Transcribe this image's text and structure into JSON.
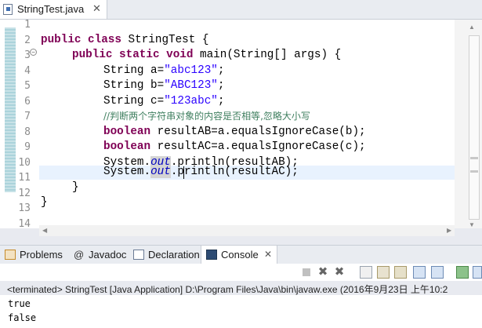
{
  "editor": {
    "tab_label": "StringTest.java",
    "tab_close": "✕",
    "line_numbers": [
      "1",
      "2",
      "3",
      "4",
      "5",
      "6",
      "7",
      "8",
      "9",
      "10",
      "11",
      "12",
      "13",
      "14"
    ],
    "code": {
      "l2_kw": "public class",
      "l2_rest": " StringTest {",
      "l3_kw": "public static void",
      "l3_rest": " main(String[] ",
      "l3_param": "args",
      "l3_end": ") {",
      "l4_pre": "String a=",
      "l4_str": "\"abc123\"",
      "l5_pre": "String b=",
      "l5_str": "\"ABC123\"",
      "l6_pre": "String c=",
      "l6_str": "\"123abc\"",
      "l7_comment": "//判断两个字符串对象的内容是否相等,忽略大小写",
      "l8_kw": "boolean",
      "l8_rest": " resultAB=a.equalsIgnoreCase(b);",
      "l9_kw": "boolean",
      "l9_rest": " resultAC=a.equalsIgnoreCase(c);",
      "l10_pre": "System.",
      "l10_field": "out",
      "l10_rest": ".println(resultAB);",
      "l11_pre": "System.",
      "l11_field": "out",
      "l11_rest": ".println(resultAC);",
      "l12": "}",
      "l13": "}"
    }
  },
  "views": {
    "tabs": [
      {
        "label": "Problems",
        "icon": "problems-icon"
      },
      {
        "label": "Javadoc",
        "icon": "javadoc-icon"
      },
      {
        "label": "Declaration",
        "icon": "declaration-icon"
      },
      {
        "label": "Console",
        "icon": "console-icon",
        "active": true
      }
    ],
    "console_close": "✕"
  },
  "console": {
    "status": "<terminated> StringTest [Java Application] D:\\Program Files\\Java\\bin\\javaw.exe (2016年9月23日 上午10:2",
    "output": [
      "true",
      "false"
    ]
  },
  "colors": {
    "keyword": "#7f0055",
    "string": "#2a00ff",
    "comment": "#3f7f5f",
    "field": "#0000c0"
  }
}
